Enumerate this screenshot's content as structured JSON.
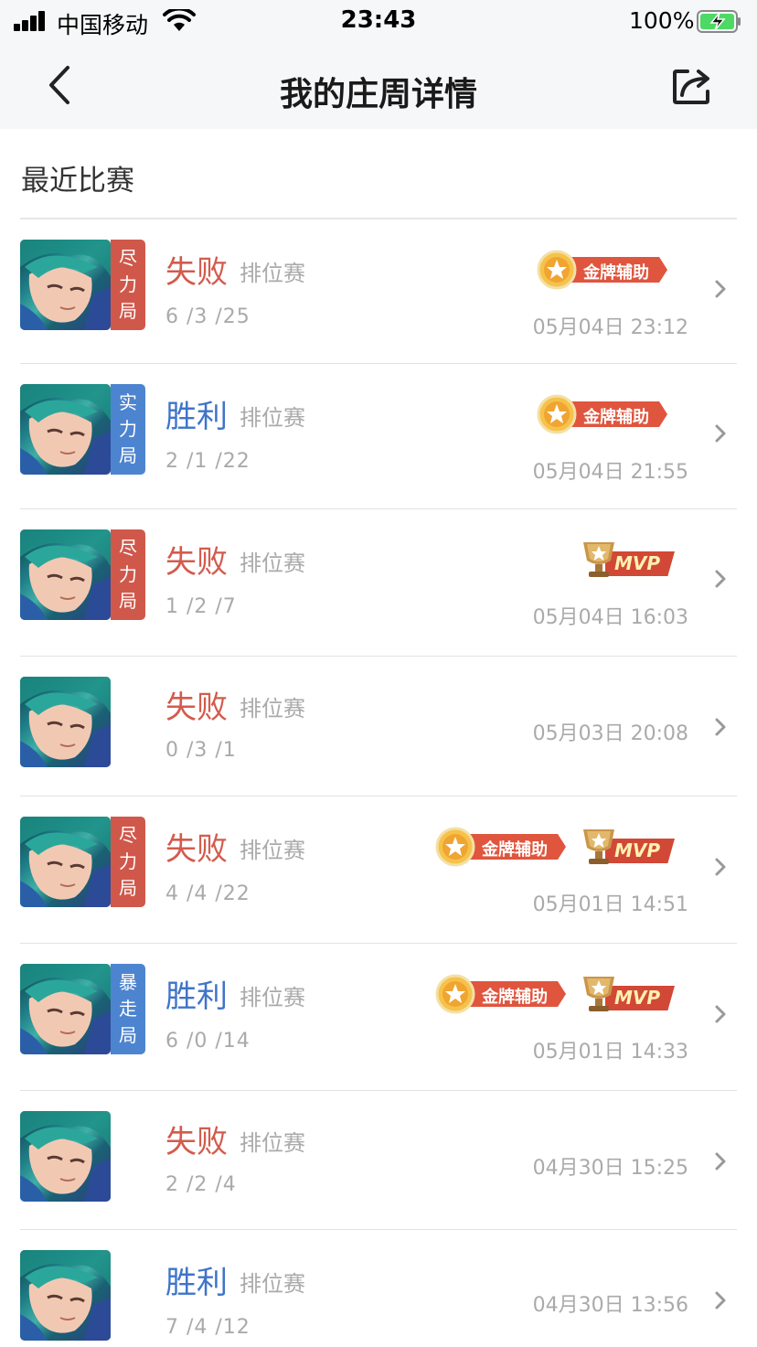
{
  "status_bar": {
    "carrier": "中国移动",
    "time": "23:43",
    "battery": "100%"
  },
  "nav": {
    "title": "我的庄周详情",
    "back_icon": "chevron-left-icon",
    "share_icon": "share-icon"
  },
  "section": {
    "title": "最近比赛"
  },
  "colors": {
    "lose": "#d35b4d",
    "win": "#3f74c9",
    "tag_red": "#d0584b",
    "tag_blue": "#4d84d0",
    "muted": "#aaaaaa"
  },
  "badge_labels": {
    "gold": "金牌辅助",
    "mvp": "MVP"
  },
  "matches": [
    {
      "result": "失败",
      "outcome": "lose",
      "mode": "排位赛",
      "kda": "6 /3 /25",
      "datetime": "05月04日 23:12",
      "tag": [
        "尽",
        "力",
        "局"
      ],
      "tag_color": "red",
      "badges": [
        "gold"
      ]
    },
    {
      "result": "胜利",
      "outcome": "win",
      "mode": "排位赛",
      "kda": "2 /1 /22",
      "datetime": "05月04日 21:55",
      "tag": [
        "实",
        "力",
        "局"
      ],
      "tag_color": "blue",
      "badges": [
        "gold"
      ]
    },
    {
      "result": "失败",
      "outcome": "lose",
      "mode": "排位赛",
      "kda": "1 /2 /7",
      "datetime": "05月04日 16:03",
      "tag": [
        "尽",
        "力",
        "局"
      ],
      "tag_color": "red",
      "badges": [
        "mvp"
      ]
    },
    {
      "result": "失败",
      "outcome": "lose",
      "mode": "排位赛",
      "kda": "0 /3 /1",
      "datetime": "05月03日 20:08",
      "tag": null,
      "tag_color": null,
      "badges": []
    },
    {
      "result": "失败",
      "outcome": "lose",
      "mode": "排位赛",
      "kda": "4 /4 /22",
      "datetime": "05月01日 14:51",
      "tag": [
        "尽",
        "力",
        "局"
      ],
      "tag_color": "red",
      "badges": [
        "gold",
        "mvp"
      ]
    },
    {
      "result": "胜利",
      "outcome": "win",
      "mode": "排位赛",
      "kda": "6 /0 /14",
      "datetime": "05月01日 14:33",
      "tag": [
        "暴",
        "走",
        "局"
      ],
      "tag_color": "blue",
      "badges": [
        "gold",
        "mvp"
      ]
    },
    {
      "result": "失败",
      "outcome": "lose",
      "mode": "排位赛",
      "kda": "2 /2 /4",
      "datetime": "04月30日 15:25",
      "tag": null,
      "tag_color": null,
      "badges": []
    },
    {
      "result": "胜利",
      "outcome": "win",
      "mode": "排位赛",
      "kda": "7 /4 /12",
      "datetime": "04月30日 13:56",
      "tag": null,
      "tag_color": null,
      "badges": []
    }
  ]
}
